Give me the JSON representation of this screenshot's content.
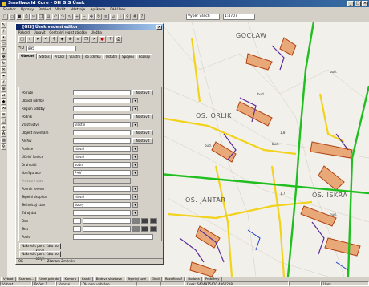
{
  "app": {
    "title": "Smallworld Core - DH GIS Úsek",
    "window_buttons": [
      "_",
      "□",
      "×"
    ]
  },
  "menubar": [
    "Soubor",
    "Úpravy",
    "Pohled",
    "Vložit",
    "Nástroje",
    "Aplikace",
    "DH Úsek"
  ],
  "toolbar": {
    "select_1": "Výběr všech",
    "select_2": "1:4707"
  },
  "map": {
    "labels": [
      {
        "text": "GOCŁAW"
      },
      {
        "text": "OS. ORLIK"
      },
      {
        "text": "OS. JANTAR"
      },
      {
        "text": "OS. ISKRA"
      }
    ],
    "small": [
      "bud.",
      "bud.",
      "bud.",
      "bud.",
      "bud.",
      "1,7",
      "1,8"
    ],
    "colors": {
      "road_green": "#1fbf1f",
      "road_yellow": "#f2d21a",
      "network_purple": "#5a2a9a",
      "network_blue": "#1a3fd0",
      "building_orange": "#e8a878",
      "building_outline": "#b04010"
    }
  },
  "dialog": {
    "title": "[GIS] Úsek vedení editor",
    "menu": [
      "Rekord",
      "Úpravit",
      "Centrální regist záložky",
      "Úložba"
    ],
    "id_label": "*ID",
    "id_value": "895",
    "tabs": [
      "Obecné",
      "Status",
      "Průzor",
      "Vlastní",
      "do zdůfku",
      "Ostatní",
      "Spojení",
      "Poznají"
    ],
    "fields": [
      {
        "label": "Potrubí",
        "value": "",
        "button": "Nastavit"
      },
      {
        "label": "Obvod údržby",
        "value": ""
      },
      {
        "label": "Region údržby",
        "value": ""
      },
      {
        "label": "Podnik",
        "value": "",
        "button": "Nastavit"
      },
      {
        "label": "Vlastnictví",
        "value": "vlastní"
      },
      {
        "label": "Objekt inventáře",
        "value": "",
        "button": "Nastavit"
      },
      {
        "label": "Archiv",
        "value": "",
        "button": "Nastavit"
      },
      {
        "label": "Funkce",
        "value": "hlavní"
      },
      {
        "label": "Účelní funkce",
        "value": "hlavní"
      },
      {
        "label": "Druh uliti",
        "value": "vodní"
      },
      {
        "label": "Konfigurace",
        "value": "P+V"
      },
      {
        "label": "Provozní stav",
        "value": ""
      },
      {
        "label": "Povrch terénu",
        "value": ""
      },
      {
        "label": "Tepelní skupina",
        "value": "hlavní"
      },
      {
        "label": "Technický stav",
        "value": "dobrý"
      },
      {
        "label": "Zdroj dat",
        "value": ""
      },
      {
        "label": "Osa",
        "value": ""
      },
      {
        "label": "Text",
        "value": ""
      },
      {
        "label": "Popis",
        "value": ""
      }
    ],
    "buttons": [
      "Nakreslit pom. čáru po kanál",
      "Nakreslit pom. čáru po oblyn"
    ],
    "status": [
      "OK",
      "Záznam Změněn"
    ]
  },
  "taskbar": [
    "Vybrat",
    "Seznam...",
    "Úsek potrubí",
    "Komora",
    "Kanál",
    "Budova sluzbova",
    "Tepelný uzel",
    "Okolí",
    "Rozdělovač",
    "Budova",
    "Problémy"
  ],
  "statusbar": [
    "Vybrat",
    "Počet: 1",
    "Vybrán",
    "DH není vybráno",
    "",
    "",
    "Úsek: 6424975420 4060218 ...",
    "",
    "Úsek"
  ]
}
